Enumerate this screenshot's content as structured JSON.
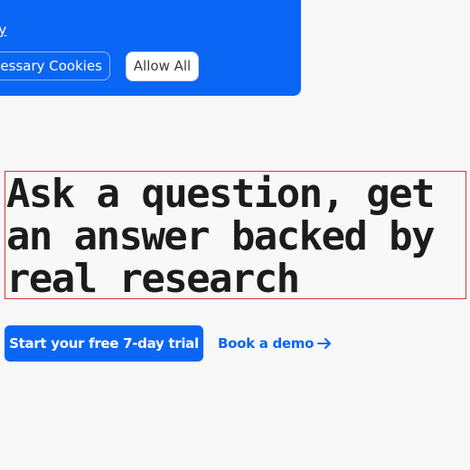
{
  "cookie_banner": {
    "policy_link": "icy",
    "necessary_button": "cessary Cookies",
    "allow_all_button": "Allow All"
  },
  "hero": {
    "headline": "Ask a question, get an answer backed by real research",
    "primary_cta": "Start your free 7-day trial",
    "secondary_cta": "Book a demo",
    "secondary_cta_icon": "arrow-right-icon"
  },
  "colors": {
    "brand_blue": "#0a66f5",
    "background": "#f8f8f8",
    "headline_outline": "#d33a3a"
  }
}
